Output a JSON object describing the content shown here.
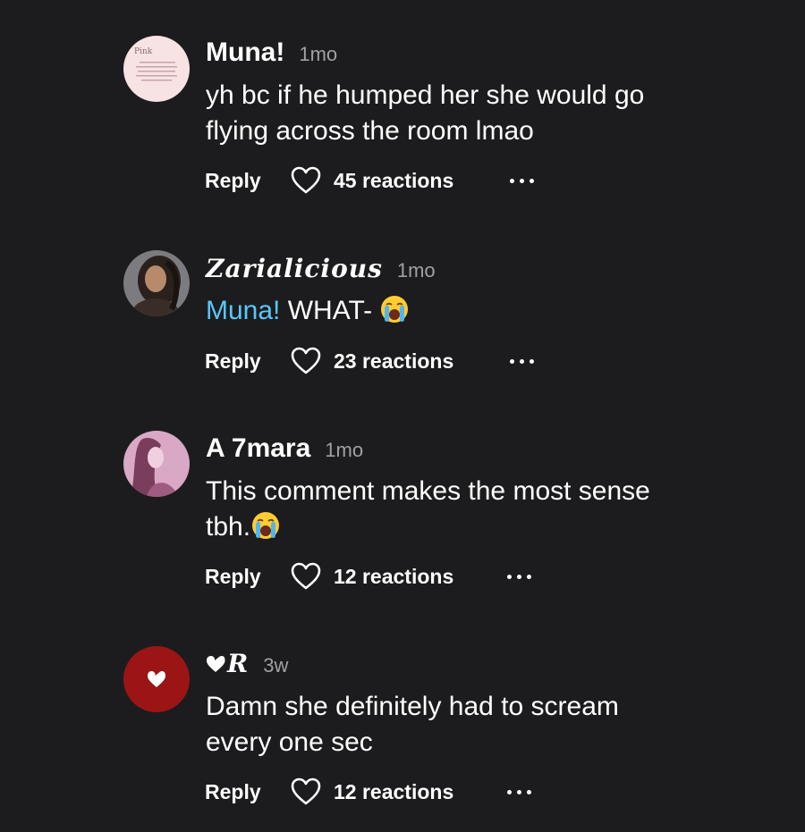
{
  "comments": [
    {
      "author": "Muna!",
      "time": "1mo",
      "lines": [
        "yh bc if he humped her she would go",
        "flying across the room lmao"
      ],
      "reply_label": "Reply",
      "reactions": "45 reactions",
      "avatar": {
        "kind": "pink-note",
        "caption": "Pink"
      }
    },
    {
      "author": "Zarialicious",
      "time": "1mo",
      "mention": "Muna!",
      "text": " WHAT- ",
      "emoji": "loudly-crying-face",
      "reply_label": "Reply",
      "reactions": "23 reactions",
      "avatar": {
        "kind": "photo-portrait"
      }
    },
    {
      "author": "A 7mara",
      "time": "1mo",
      "lines": [
        "This comment makes the most sense",
        "tbh."
      ],
      "emoji": "loudly-crying-face",
      "reply_label": "Reply",
      "reactions": "12 reactions",
      "avatar": {
        "kind": "pink-illustration"
      }
    },
    {
      "author": "R",
      "time": "3w",
      "lines": [
        "Damn she definitely had to scream",
        "every one sec"
      ],
      "reply_label": "Reply",
      "reactions": "12 reactions",
      "avatar": {
        "kind": "red-heart"
      }
    }
  ],
  "colors": {
    "background": "#1c1c1e",
    "text": "#ffffff",
    "muted": "#a0a0a5",
    "mention": "#5ac8fa",
    "red_avatar": "#9b1515"
  }
}
